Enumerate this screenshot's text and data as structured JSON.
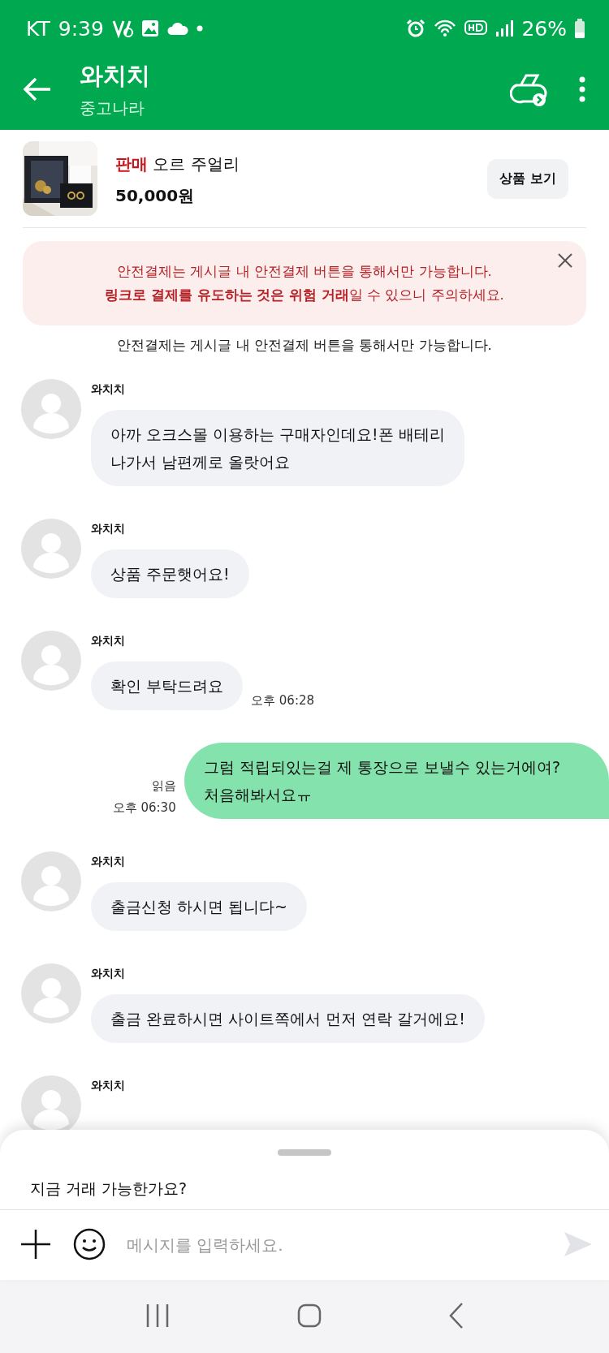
{
  "status_bar": {
    "carrier": "KT",
    "time": "9:39",
    "battery": "26%"
  },
  "header": {
    "title": "와치치",
    "subtitle": "중고나라"
  },
  "product": {
    "kind": "picture",
    "status": "판매",
    "name": "오르 주얼리",
    "price": "50,000원",
    "button": "상품 보기"
  },
  "warning": {
    "lines": [
      "안전결제는 게시글 내 안전결제 버튼을 통해서만 가능합니다.",
      "**링크로 결제를 유도하는 것은 위험 거래**일 수 있으니 주의하세요."
    ]
  },
  "system_notice": "안전결제는 게시글 내 안전결제 버튼을 통해서만 가능합니다.",
  "messages": [
    {
      "kind": "received",
      "sender": "와치치",
      "lines": [
        "아까 오크스몰 이용하는 구매자인데요!폰 배테리",
        "나가서 남편께로 올랏어요"
      ]
    },
    {
      "kind": "received",
      "sender": "와치치",
      "lines": [
        "상품 주문햇어요!"
      ]
    },
    {
      "kind": "received",
      "sender": "와치치",
      "lines": [
        "확인 부탁드려요"
      ],
      "time": "오후 06:28"
    },
    {
      "kind": "sent",
      "lines": [
        "그럼 적립되있는걸 제 통장으로 보낼수 있는거에여?",
        "처음해봐서요ㅠ"
      ],
      "read": "읽음",
      "time": "오후 06:30"
    },
    {
      "kind": "received",
      "sender": "와치치",
      "lines": [
        "출금신청 하시면 됩니다~"
      ]
    },
    {
      "kind": "received",
      "sender": "와치치",
      "lines": [
        "출금 완료하시면 사이트쪽에서 먼저 연락 갈거에요!"
      ]
    },
    {
      "kind": "received",
      "sender": "와치치"
    }
  ],
  "sheet": {
    "suggestion": "지금 거래 가능한가요?",
    "input": {
      "placeholder": "메시지를 입력하세요."
    }
  }
}
